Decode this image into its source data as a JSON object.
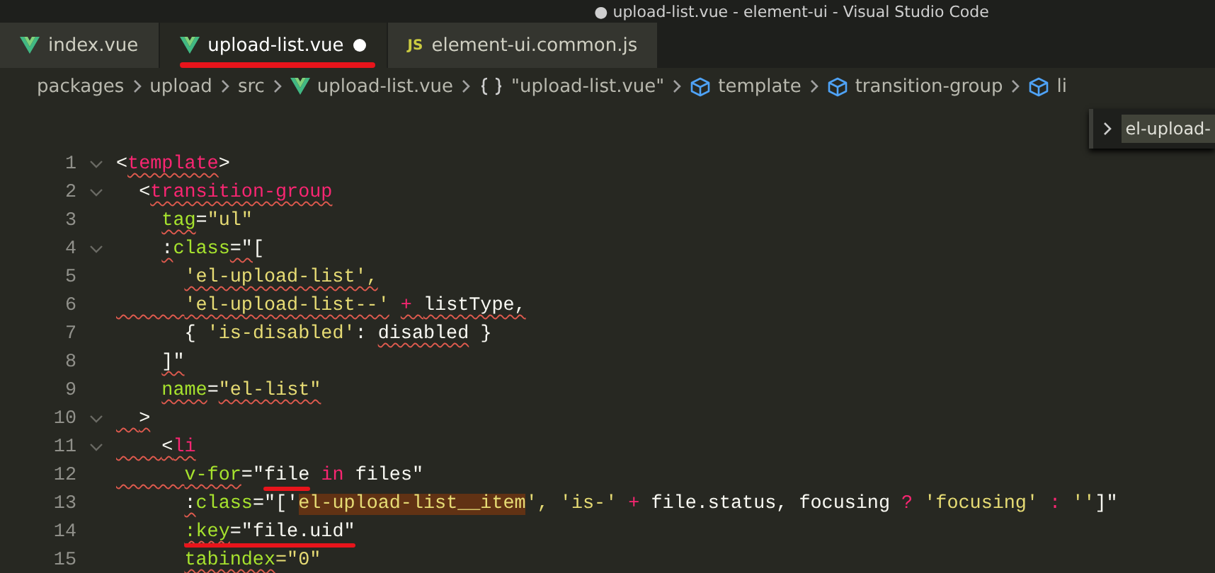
{
  "window": {
    "title": "● upload-list.vue - element-ui - Visual Studio Code"
  },
  "tabs": [
    {
      "label": "index.vue",
      "kind": "vue",
      "selected": false,
      "dirty": false,
      "marked": false
    },
    {
      "label": "upload-list.vue",
      "kind": "vue",
      "selected": true,
      "dirty": true,
      "marked": true
    },
    {
      "label": "element-ui.common.js",
      "kind": "js",
      "icon_text": "JS",
      "selected": false,
      "dirty": false,
      "marked": false
    }
  ],
  "breadcrumbs": [
    {
      "label": "packages",
      "kind": "folder"
    },
    {
      "label": "upload",
      "kind": "folder"
    },
    {
      "label": "src",
      "kind": "folder"
    },
    {
      "label": "upload-list.vue",
      "kind": "vue"
    },
    {
      "label": "\"upload-list.vue\"",
      "kind": "braces"
    },
    {
      "label": "template",
      "kind": "element"
    },
    {
      "label": "transition-group",
      "kind": "element"
    },
    {
      "label": "li",
      "kind": "element"
    }
  ],
  "sticky_widget": {
    "label": "el-upload-"
  },
  "lines": [
    {
      "number": "1",
      "fold": true,
      "tokens": [
        {
          "text": "<",
          "kind": "punct"
        },
        {
          "text": "template",
          "kind": "tag",
          "err": true
        },
        {
          "text": ">",
          "kind": "punct"
        }
      ]
    },
    {
      "number": "2",
      "fold": true,
      "tokens": [
        {
          "text": "  <",
          "kind": "punct"
        },
        {
          "text": "transition-group",
          "kind": "tag",
          "err": true
        }
      ]
    },
    {
      "number": "3",
      "fold": false,
      "tokens": [
        {
          "text": "    tag",
          "kind": "attr",
          "err": true
        },
        {
          "text": "=",
          "kind": "punct"
        },
        {
          "text": "\"ul\"",
          "kind": "string"
        }
      ]
    },
    {
      "number": "4",
      "fold": true,
      "tokens": [
        {
          "text": "    :",
          "kind": "punct",
          "err": true
        },
        {
          "text": "class",
          "kind": "attr"
        },
        {
          "text": "=\"",
          "kind": "punct",
          "err": true
        },
        {
          "text": "[",
          "kind": "punct"
        }
      ]
    },
    {
      "number": "5",
      "fold": false,
      "tokens": [
        {
          "text": "      'el-upload-list',",
          "kind": "string",
          "err": true
        }
      ]
    },
    {
      "number": "6",
      "fold": false,
      "tokens": [
        {
          "text": "      'el-upload-list--'",
          "kind": "string",
          "err": true,
          "err_indent": true
        },
        {
          "text": " + ",
          "kind": "op",
          "err": true
        },
        {
          "text": "listType,",
          "kind": "plain",
          "err": true
        }
      ]
    },
    {
      "number": "7",
      "fold": false,
      "tokens": [
        {
          "text": "      { ",
          "kind": "punct"
        },
        {
          "text": "'is-disabled'",
          "kind": "string"
        },
        {
          "text": ": ",
          "kind": "punct"
        },
        {
          "text": "disabled",
          "kind": "plain",
          "err": true
        },
        {
          "text": " }",
          "kind": "punct"
        }
      ]
    },
    {
      "number": "8",
      "fold": false,
      "tokens": [
        {
          "text": "    ]\"",
          "kind": "punct",
          "err": true
        }
      ]
    },
    {
      "number": "9",
      "fold": false,
      "tokens": [
        {
          "text": "    name",
          "kind": "attr",
          "err": true
        },
        {
          "text": "=",
          "kind": "punct"
        },
        {
          "text": "\"el-list\"",
          "kind": "string",
          "err": true
        }
      ]
    },
    {
      "number": "10",
      "fold": true,
      "tokens": [
        {
          "text": "  >",
          "kind": "punct",
          "err": true,
          "err_indent": true
        }
      ]
    },
    {
      "number": "11",
      "fold": true,
      "tokens": [
        {
          "text": "    <",
          "kind": "punct",
          "err": true,
          "err_indent": true
        },
        {
          "text": "li",
          "kind": "tag",
          "err": true
        }
      ]
    },
    {
      "number": "12",
      "fold": false,
      "tokens": [
        {
          "text": "      v-for",
          "kind": "attr",
          "err": true,
          "err_indent": true
        },
        {
          "text": "=\"",
          "kind": "punct"
        },
        {
          "text": "file",
          "kind": "plain",
          "marked": true
        },
        {
          "text": " in",
          "kind": "keyword"
        },
        {
          "text": " files\"",
          "kind": "plain"
        }
      ]
    },
    {
      "number": "13",
      "fold": false,
      "tokens": [
        {
          "text": "      :",
          "kind": "punct",
          "err": true
        },
        {
          "text": "class",
          "kind": "attr"
        },
        {
          "text": "=\"['",
          "kind": "plain"
        },
        {
          "text": "el-upload-list__item",
          "kind": "string",
          "highlight": true
        },
        {
          "text": "', 'is-' ",
          "kind": "string"
        },
        {
          "text": "+",
          "kind": "op"
        },
        {
          "text": " file.status, focusing ",
          "kind": "plain"
        },
        {
          "text": "?",
          "kind": "op"
        },
        {
          "text": " 'focusing' ",
          "kind": "string"
        },
        {
          "text": ":",
          "kind": "op"
        },
        {
          "text": " ''",
          "kind": "string"
        },
        {
          "text": "]\"",
          "kind": "plain"
        }
      ]
    },
    {
      "number": "14",
      "fold": false,
      "tokens": [
        {
          "text": "      :key",
          "kind": "attr",
          "err": true,
          "marked": true
        },
        {
          "text": "=\"file.uid\"",
          "kind": "plain",
          "marked": true
        }
      ]
    },
    {
      "number": "15",
      "fold": false,
      "tokens": [
        {
          "text": "      tabindex",
          "kind": "attr",
          "err": true
        },
        {
          "text": "=\"0\"",
          "kind": "string"
        }
      ]
    }
  ]
}
